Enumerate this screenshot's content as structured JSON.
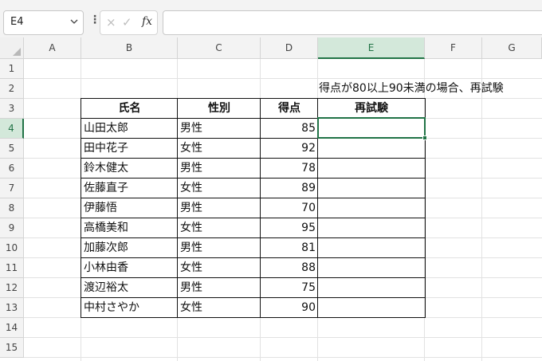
{
  "formula_bar": {
    "name_box": "E4",
    "name_box_dropdown_icon": "chevron-down-icon",
    "cancel_icon": "×",
    "confirm_icon": "✓",
    "function_label": "fx",
    "formula": ""
  },
  "columns": [
    "A",
    "B",
    "C",
    "D",
    "E",
    "F",
    "G"
  ],
  "rows": [
    "1",
    "2",
    "3",
    "4",
    "5",
    "6",
    "7",
    "8",
    "9",
    "10",
    "11",
    "12",
    "13",
    "14",
    "15"
  ],
  "note": "得点が80以上90未満の場合、再試験",
  "table": {
    "headers": [
      "氏名",
      "性別",
      "得点",
      "再試験"
    ],
    "rows": [
      {
        "name": "山田太郎",
        "gender": "男性",
        "score": "85",
        "retest": ""
      },
      {
        "name": "田中花子",
        "gender": "女性",
        "score": "92",
        "retest": ""
      },
      {
        "name": "鈴木健太",
        "gender": "男性",
        "score": "78",
        "retest": ""
      },
      {
        "name": "佐藤直子",
        "gender": "女性",
        "score": "89",
        "retest": ""
      },
      {
        "name": "伊藤悟",
        "gender": "男性",
        "score": "70",
        "retest": ""
      },
      {
        "name": "高橋美和",
        "gender": "女性",
        "score": "95",
        "retest": ""
      },
      {
        "name": "加藤次郎",
        "gender": "男性",
        "score": "81",
        "retest": ""
      },
      {
        "name": "小林由香",
        "gender": "女性",
        "score": "88",
        "retest": ""
      },
      {
        "name": "渡辺裕太",
        "gender": "男性",
        "score": "75",
        "retest": ""
      },
      {
        "name": "中村さやか",
        "gender": "女性",
        "score": "90",
        "retest": ""
      }
    ]
  },
  "selected_cell": "E4",
  "colors": {
    "accent": "#217346",
    "header_bg": "#f3f3f3",
    "active_header_bg": "#d3e8da"
  }
}
